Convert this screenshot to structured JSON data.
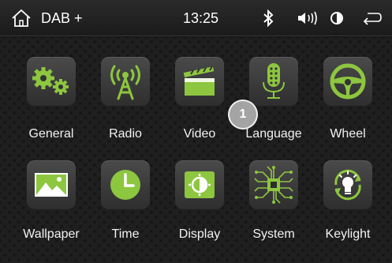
{
  "status_bar": {
    "source_label": "DAB +",
    "time": "13:25"
  },
  "menu": {
    "items": [
      {
        "label": "General",
        "icon": "gears-icon"
      },
      {
        "label": "Radio",
        "icon": "radio-tower-icon"
      },
      {
        "label": "Video",
        "icon": "clapperboard-icon"
      },
      {
        "label": "Language",
        "icon": "microphone-icon"
      },
      {
        "label": "Wheel",
        "icon": "steering-wheel-icon"
      },
      {
        "label": "Wallpaper",
        "icon": "landscape-image-icon"
      },
      {
        "label": "Time",
        "icon": "clock-icon"
      },
      {
        "label": "Display",
        "icon": "brightness-icon"
      },
      {
        "label": "System",
        "icon": "chip-icon"
      },
      {
        "label": "Keylight",
        "icon": "lightbulb-icon"
      }
    ]
  },
  "annotation": {
    "number": "1"
  },
  "colors": {
    "accent": "#8dc63f",
    "status_bar": "#222222",
    "tile": "#3c3c3c"
  }
}
